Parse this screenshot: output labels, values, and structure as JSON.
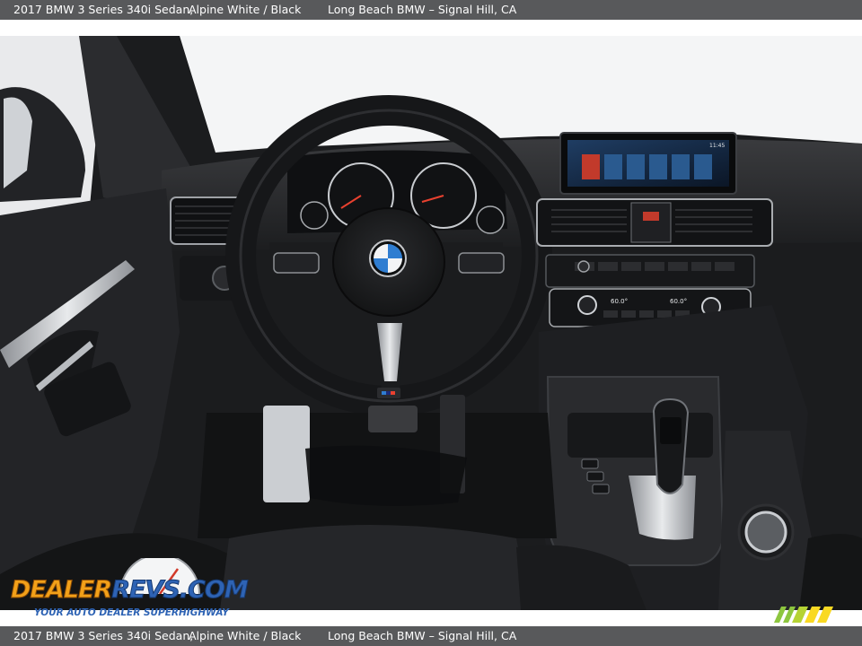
{
  "header": {
    "vehicle_title": "2017 BMW 3 Series 340i Sedan,",
    "color_info": "Alpine White / Black",
    "dealer": "Long Beach BMW – Signal Hill, CA"
  },
  "footer": {
    "vehicle_title": "2017 BMW 3 Series 340i Sedan,",
    "color_info": "Alpine White / Black",
    "dealer": "Long Beach BMW – Signal Hill, CA"
  },
  "watermark": {
    "brand_part1": "DEALER",
    "brand_part2": "REVS",
    "brand_part3": ".COM",
    "tagline": "YOUR AUTO DEALER SUPERHIGHWAY"
  },
  "photo": {
    "subject": "BMW 3 Series interior dashboard",
    "climate_left": "60.0°",
    "climate_right": "60.0°",
    "screen_clock": "11:45"
  },
  "colors": {
    "bar_bg": "#58595b",
    "bar_text": "#ffffff",
    "logo_orange": "#f2a019",
    "logo_blue": "#2e63b4",
    "stripe_green": "#8dc63f",
    "stripe_yellow": "#f9d923"
  }
}
